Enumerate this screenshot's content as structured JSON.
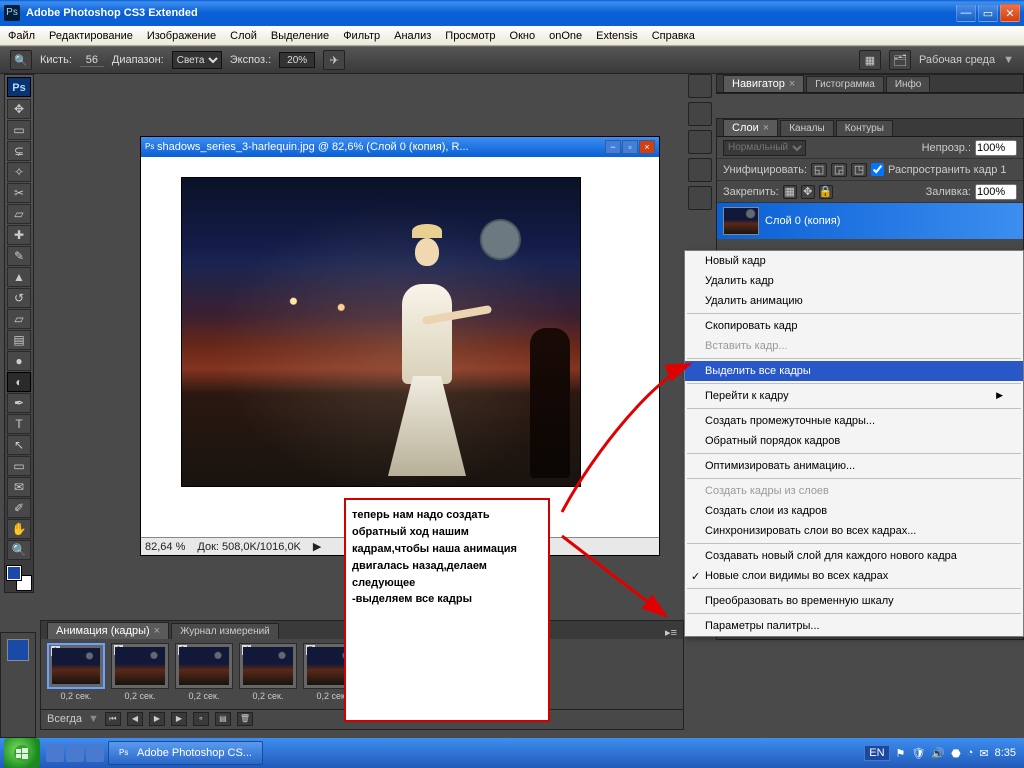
{
  "title": "Adobe Photoshop CS3 Extended",
  "menubar": [
    "Файл",
    "Редактирование",
    "Изображение",
    "Слой",
    "Выделение",
    "Фильтр",
    "Анализ",
    "Просмотр",
    "Окно",
    "onOne",
    "Extensis",
    "Справка"
  ],
  "optbar": {
    "brush_label": "Кисть:",
    "brush_size": "56",
    "range_label": "Диапазон:",
    "range_value": "Света",
    "expo_label": "Экспоз.:",
    "expo_value": "20%",
    "workspace": "Рабочая среда"
  },
  "doc": {
    "title": "shadows_series_3-harlequin.jpg @ 82,6% (Слой 0 (копия), R...",
    "zoom": "82,64 %",
    "info": "Док: 508,0K/1016,0K"
  },
  "nav_tabs": [
    "Навигатор",
    "Гистограмма",
    "Инфо"
  ],
  "layer_tabs": [
    "Слои",
    "Каналы",
    "Контуры"
  ],
  "layers": {
    "mode": "Нормальный",
    "opac_label": "Непрозр.:",
    "opac_value": "100%",
    "unify": "Унифицировать:",
    "propagate": "Распространить кадр 1",
    "lock": "Закрепить:",
    "fill_label": "Заливка:",
    "fill_value": "100%",
    "layer_name": "Слой 0 (копия)"
  },
  "ctx": {
    "new": "Новый кадр",
    "del": "Удалить кадр",
    "dela": "Удалить анимацию",
    "copy": "Скопировать кадр",
    "paste": "Вставить кадр...",
    "selall": "Выделить все кадры",
    "goto": "Перейти к кадру",
    "tween": "Создать промежуточные кадры...",
    "reverse": "Обратный порядок кадров",
    "optim": "Оптимизировать анимацию...",
    "fromlayers": "Создать кадры из слоев",
    "tolayers": "Создать слои из кадров",
    "syncl": "Синхронизировать слои во всех кадрах...",
    "newlayer": "Создавать новый слой для каждого нового кадра",
    "visible": "Новые слои видимы во всех кадрах",
    "totl": "Преобразовать во временную шкалу",
    "palopt": "Параметры палитры..."
  },
  "anim": {
    "tab1": "Анимация (кадры)",
    "tab2": "Журнал измерений",
    "delay": "0,2 сек.",
    "loop": "Всегда"
  },
  "annot": "теперь нам надо создать обратный ход нашим кадрам,чтобы наша анимация двигалась назад,делаем следующее\n-выделяем все кадры",
  "taskbar": {
    "app": "Adobe Photoshop CS...",
    "lang": "EN",
    "clock": "8:35"
  }
}
